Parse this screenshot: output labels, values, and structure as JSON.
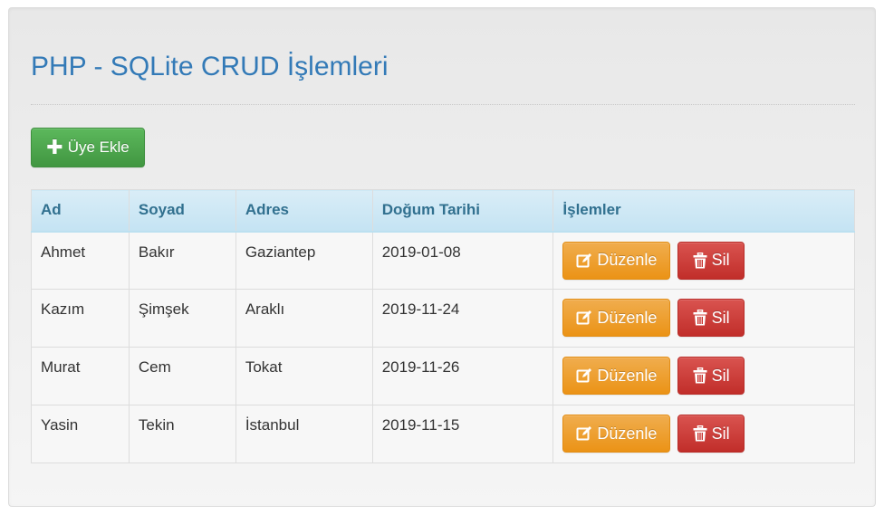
{
  "page": {
    "title": "PHP - SQLite CRUD İşlemleri"
  },
  "toolbar": {
    "add_label": "Üye Ekle",
    "add_icon": "plus-icon"
  },
  "table": {
    "headers": [
      "Ad",
      "Soyad",
      "Adres",
      "Doğum Tarihi",
      "İşlemler"
    ],
    "rows": [
      {
        "ad": "Ahmet",
        "soyad": "Bakır",
        "adres": "Gaziantep",
        "dogum": "2019-01-08",
        "edit_label": "Düzenle",
        "delete_label": "Sil"
      },
      {
        "ad": "Kazım",
        "soyad": "Şimşek",
        "adres": "Araklı",
        "dogum": "2019-11-24",
        "edit_label": "Düzenle",
        "delete_label": "Sil"
      },
      {
        "ad": "Murat",
        "soyad": "Cem",
        "adres": "Tokat",
        "dogum": "2019-11-26",
        "edit_label": "Düzenle",
        "delete_label": "Sil"
      },
      {
        "ad": "Yasin",
        "soyad": "Tekin",
        "adres": "İstanbul",
        "dogum": "2019-11-15",
        "edit_label": "Düzenle",
        "delete_label": "Sil"
      }
    ]
  },
  "icons": {
    "edit": "edit-icon",
    "delete": "trash-icon"
  },
  "colors": {
    "title": "#337ab7",
    "success": "#5cb85c",
    "warning": "#f0ad4e",
    "danger": "#d9534f",
    "header_bg": "#d9edf7",
    "header_text": "#31708f"
  }
}
